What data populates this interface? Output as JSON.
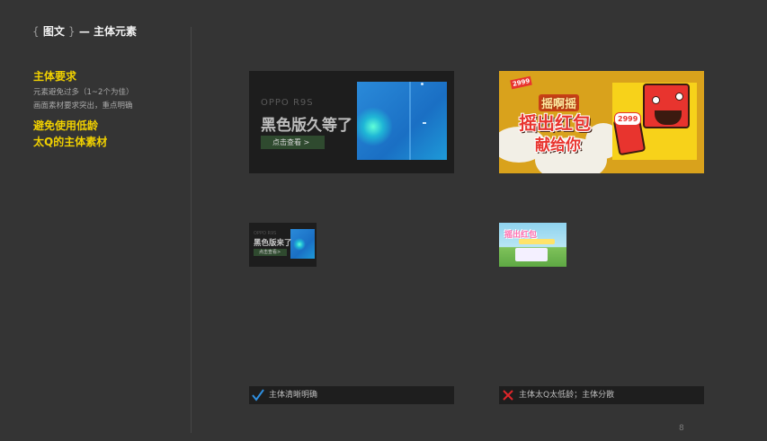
{
  "header": {
    "bracket_open": "{",
    "section": "图文",
    "bracket_close": "}",
    "dash": "—",
    "topic": "主体元素"
  },
  "requirements": {
    "heading": "主体要求",
    "lines": [
      "元素避免过多（1~2个为佳）",
      "画面素材要求突出，重点明确"
    ]
  },
  "avoid": {
    "lines": [
      "避免使用低龄",
      "太Q的主体素材"
    ]
  },
  "banners": {
    "good": {
      "brand": "OPPO   R9S",
      "headline": "黑色版久等了",
      "cta": "点击查看 >"
    },
    "good_small": {
      "brand": "OPPO R9S",
      "headline": "黑色版来了",
      "cta": "点击查看>"
    },
    "bad": {
      "tag": "2999",
      "line1": "摇啊摇",
      "line2": "摇出红包",
      "line3": "献给你",
      "badge": "2999"
    },
    "bad_small": {
      "text": "摇出红包"
    }
  },
  "captions": {
    "good": "主体清晰明确",
    "bad": "主体太Q太低龄；主体分散"
  },
  "colors": {
    "background": "#343434",
    "accent_yellow": "#f0d000",
    "good_mark": "#2f8fe0",
    "bad_mark": "#e0262a"
  },
  "page_number": "8"
}
